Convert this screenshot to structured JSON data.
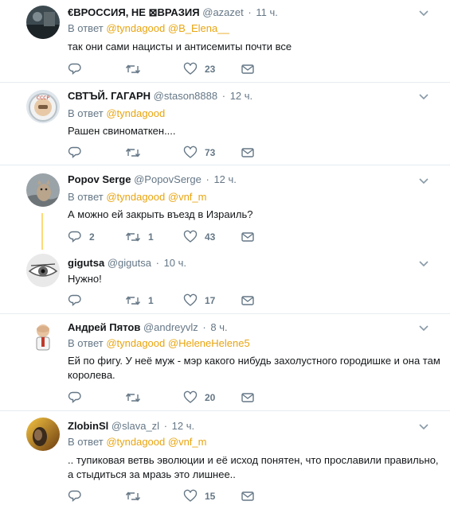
{
  "tweets": [
    {
      "name": "€ВРОССИЯ, НЕ ⊠ВРАЗИЯ",
      "handle": "@azazet",
      "time": "11 ч.",
      "reply_prefix": "В ответ",
      "mentions": [
        "@tyndagood",
        "@B_Elena__"
      ],
      "text": "так они сами нацисты и антисемиты почти все",
      "reply_count": "",
      "retweet_count": "",
      "like_count": "23"
    },
    {
      "name": "СВТЪЙ. ГАГАРН",
      "handle": "@stason8888",
      "time": "12 ч.",
      "reply_prefix": "В ответ",
      "mentions": [
        "@tyndagood"
      ],
      "text": "Рашен свиноматкен....",
      "reply_count": "",
      "retweet_count": "",
      "like_count": "73"
    },
    {
      "name": "Popov Serge",
      "handle": "@PopovSerge",
      "time": "12 ч.",
      "reply_prefix": "В ответ",
      "mentions": [
        "@tyndagood",
        "@vnf_m"
      ],
      "text": "А можно ей закрыть въезд в Израиль?",
      "reply_count": "2",
      "retweet_count": "1",
      "like_count": "43"
    },
    {
      "name": "gigutsa",
      "handle": "@gigutsa",
      "time": "10 ч.",
      "reply_prefix": "",
      "mentions": [],
      "text": "Нужно!",
      "reply_count": "",
      "retweet_count": "1",
      "like_count": "17"
    },
    {
      "name": "Андрей Пятов",
      "handle": "@andreyvlz",
      "time": "8 ч.",
      "reply_prefix": "В ответ",
      "mentions": [
        "@tyndagood",
        "@HeleneHelene5"
      ],
      "text": "Ей по фигу. У неё муж - мэр какого нибудь захолустного городишке и она там королева.",
      "reply_count": "",
      "retweet_count": "",
      "like_count": "20"
    },
    {
      "name": "ZlobinSl",
      "handle": "@slava_zl",
      "time": "12 ч.",
      "reply_prefix": "В ответ",
      "mentions": [
        "@tyndagood",
        "@vnf_m"
      ],
      "text": ".. тупиковая ветвь эволюции и её исход понятен, что прославили правильно, а стыдиться за мразь это лишнее..",
      "reply_count": "",
      "retweet_count": "",
      "like_count": "15"
    }
  ],
  "icons": {
    "reply": "reply-icon",
    "retweet": "retweet-icon",
    "like": "heart-icon",
    "dm": "envelope-icon",
    "more": "chevron-down-icon"
  },
  "colors": {
    "mention": "#e8a510",
    "secondary": "#657786",
    "thread": "#ffd97a",
    "divider": "#e6ecf0"
  }
}
